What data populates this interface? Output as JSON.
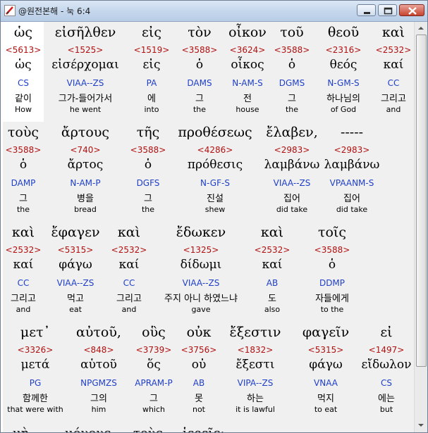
{
  "window": {
    "title": "@원전본해 - 눅 6:4"
  },
  "colors": {
    "strong": "#b01010",
    "morph": "#1f3fc8",
    "selection": "#ffffff",
    "background": "#f0f0f0"
  },
  "rows": [
    [
      {
        "greek": "ὡς",
        "strong": "<5613>",
        "lemma": "ὡς",
        "morph": "CS",
        "korean": "같이",
        "english": "How"
      },
      {
        "greek": "εἰσῆλθεν",
        "strong": "<1525>",
        "lemma": "εἰσέρχομαι",
        "morph": "VIAA--ZS",
        "korean": "그가-들어가서",
        "english": "he went"
      },
      {
        "greek": "εἰς",
        "strong": "<1519>",
        "lemma": "εἰς",
        "morph": "PA",
        "korean": "에",
        "english": "into"
      },
      {
        "greek": "τὸν",
        "strong": "<3588>",
        "lemma": "ὁ",
        "morph": "DAMS",
        "korean": "그",
        "english": "the"
      },
      {
        "greek": "οἶκον",
        "strong": "<3624>",
        "lemma": "οἶκος",
        "morph": "N-AM-S",
        "korean": "전",
        "english": "house"
      },
      {
        "greek": "τοῦ",
        "strong": "<3588>",
        "lemma": "ὁ",
        "morph": "DGMS",
        "korean": "그",
        "english": "the"
      },
      {
        "greek": "θεοῦ",
        "strong": "<2316>",
        "lemma": "θεός",
        "morph": "N-GM-S",
        "korean": "하나님의",
        "english": "of God"
      },
      {
        "greek": "καὶ",
        "strong": "<2532>",
        "lemma": "καί",
        "morph": "CC",
        "korean": "그리고",
        "english": "and"
      }
    ],
    [
      {
        "greek": "τοὺς",
        "strong": "<3588>",
        "lemma": "ὁ",
        "morph": "DAMP",
        "korean": "그",
        "english": "the"
      },
      {
        "greek": "ἄρτους",
        "strong": "<740>",
        "lemma": "ἄρτος",
        "morph": "N-AM-P",
        "korean": "병을",
        "english": "bread"
      },
      {
        "greek": "τῆς",
        "strong": "<3588>",
        "lemma": "ὁ",
        "morph": "DGFS",
        "korean": "그",
        "english": "the"
      },
      {
        "greek": "προθέσεως",
        "strong": "<4286>",
        "lemma": "πρόθεσις",
        "morph": "N-GF-S",
        "korean": "진설",
        "english": "shew"
      },
      {
        "greek": "ἔλαβεν,",
        "strong": "<2983>",
        "lemma": "λαμβάνω",
        "morph": "VIAA--ZS",
        "korean": "집어",
        "english": "did take"
      },
      {
        "greek": "-----",
        "strong": "<2983>",
        "lemma": "λαμβάνω",
        "morph": "VPAANM-S",
        "korean": "집어",
        "english": "did take"
      }
    ],
    [
      {
        "greek": "καὶ",
        "strong": "<2532>",
        "lemma": "καί",
        "morph": "CC",
        "korean": "그리고",
        "english": "and"
      },
      {
        "greek": "ἔφαγεν",
        "strong": "<5315>",
        "lemma": "φάγω",
        "morph": "VIAA--ZS",
        "korean": "먹고",
        "english": "eat"
      },
      {
        "greek": "καὶ",
        "strong": "<2532>",
        "lemma": "καί",
        "morph": "CC",
        "korean": "그리고",
        "english": "and"
      },
      {
        "greek": "ἔδωκεν",
        "strong": "<1325>",
        "lemma": "δίδωμι",
        "morph": "VIAA--ZS",
        "korean": "주지 아니 하였느냐",
        "english": "gave"
      },
      {
        "greek": "καὶ",
        "strong": "<2532>",
        "lemma": "καί",
        "morph": "AB",
        "korean": "도",
        "english": "also"
      },
      {
        "greek": "τοῖς",
        "strong": "<3588>",
        "lemma": "ὁ",
        "morph": "DDMP",
        "korean": "자들에게",
        "english": "to the"
      }
    ],
    [
      {
        "greek": "μετ᾽",
        "strong": "<3326>",
        "lemma": "μετά",
        "morph": "PG",
        "korean": "함께한",
        "english": "that were with"
      },
      {
        "greek": "αὐτοῦ,",
        "strong": "<848>",
        "lemma": "αὑτοῦ",
        "morph": "NPGMZS",
        "korean": "그의",
        "english": "him"
      },
      {
        "greek": "οὓς",
        "strong": "<3739>",
        "lemma": "ὅς",
        "morph": "APRAM-P",
        "korean": "그",
        "english": "which"
      },
      {
        "greek": "οὐκ",
        "strong": "<3756>",
        "lemma": "οὐ",
        "morph": "AB",
        "korean": "못",
        "english": "not"
      },
      {
        "greek": "ἔξεστιν",
        "strong": "<1832>",
        "lemma": "ἔξεστι",
        "morph": "VIPA--ZS",
        "korean": "하는",
        "english": "it is lawful"
      },
      {
        "greek": "φαγεῖν",
        "strong": "<5315>",
        "lemma": "φάγω",
        "morph": "VNAA",
        "korean": "먹지",
        "english": "to eat"
      },
      {
        "greek": "εἰ",
        "strong": "<1497>",
        "lemma": "εἴδωλον",
        "morph": "CS",
        "korean": "에는",
        "english": "but"
      }
    ]
  ],
  "partial_row": [
    "μὴ",
    "μόνους",
    "τοὺς",
    "ἱερεῖς;"
  ]
}
